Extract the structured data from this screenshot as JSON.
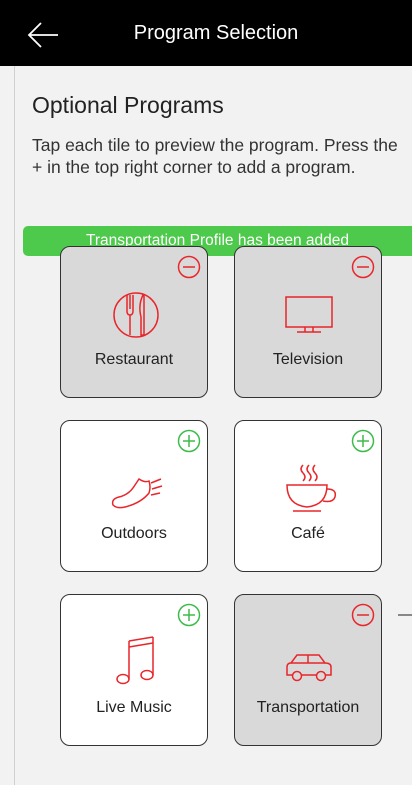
{
  "header": {
    "title": "Program Selection"
  },
  "section": {
    "title": "Optional Programs",
    "description": "Tap each tile to preview the program. Press the + in the top right corner to add a program."
  },
  "banner": {
    "text": "Transportation Profile has been added"
  },
  "colors": {
    "accent_red": "#e8262b",
    "accent_green": "#3dbb4a",
    "banner_green": "#4dc94b"
  },
  "tiles": [
    {
      "label": "Restaurant",
      "state": "added",
      "badge": "minus-icon",
      "icon": "plate-cutlery-icon"
    },
    {
      "label": "Television",
      "state": "added",
      "badge": "minus-icon",
      "icon": "tv-icon"
    },
    {
      "label": "Outdoors",
      "state": "available",
      "badge": "plus-icon",
      "icon": "shoe-icon"
    },
    {
      "label": "Café",
      "state": "available",
      "badge": "plus-icon",
      "icon": "coffee-cup-icon"
    },
    {
      "label": "Live Music",
      "state": "available",
      "badge": "plus-icon",
      "icon": "music-note-icon"
    },
    {
      "label": "Transportation",
      "state": "added",
      "badge": "minus-icon",
      "icon": "car-icon"
    }
  ]
}
